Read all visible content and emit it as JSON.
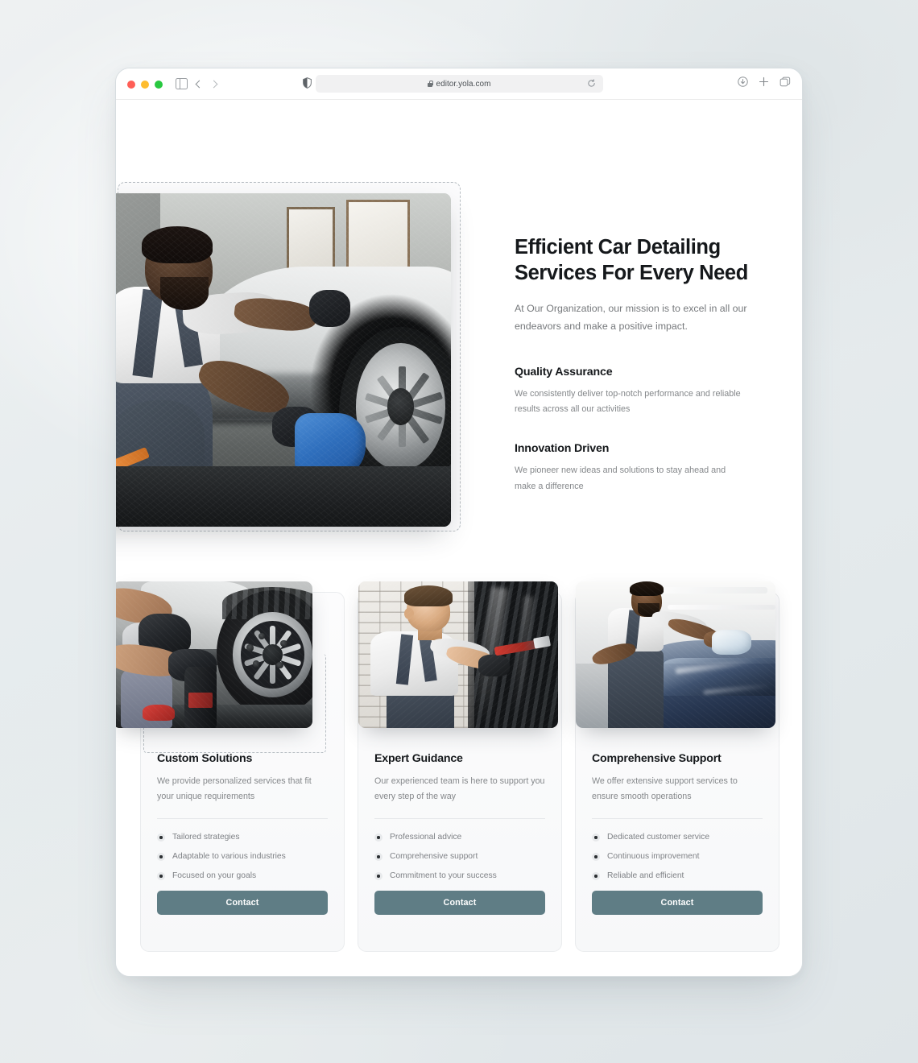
{
  "browser": {
    "url": "editor.yola.com",
    "traffic_lights": [
      "close",
      "minimize",
      "zoom"
    ],
    "icons": {
      "sidebar": "sidebar-icon",
      "back": "chevron-left-icon",
      "forward": "chevron-right-icon",
      "shield": "privacy-shield-icon",
      "lock": "lock-icon",
      "reload": "reload-icon",
      "download": "download-icon",
      "new_tab": "plus-icon",
      "tab_overview": "tab-overview-icon"
    }
  },
  "hero": {
    "heading": "Efficient Car Detailing Services For Every Need",
    "lead": "At Our Organization, our mission is to excel in all our endeavors and make a positive impact.",
    "image_alt": "Detailer crouching and wiping the wheel of a white car",
    "features": [
      {
        "title": "Quality Assurance",
        "body": "We consistently deliver top-notch performance and reliable results across all our activities"
      },
      {
        "title": "Innovation Driven",
        "body": "We pioneer new ideas and solutions to stay ahead and make a difference"
      }
    ]
  },
  "cards": [
    {
      "title": "Custom Solutions",
      "desc": "We provide personalized services that fit your unique requirements",
      "image_alt": "Gloved hands cleaning an alloy wheel with a spray bottle",
      "bullets": [
        "Tailored strategies",
        "Adaptable to various industries",
        "Focused on your goals"
      ],
      "button": "Contact"
    },
    {
      "title": "Expert Guidance",
      "desc": "Our experienced team is here to support you every step of the way",
      "image_alt": "Technician using a detailing brush on a car grille",
      "bullets": [
        "Professional advice",
        "Comprehensive support",
        "Commitment to your success"
      ],
      "button": "Contact"
    },
    {
      "title": "Comprehensive Support",
      "desc": "We offer extensive support services to ensure smooth operations",
      "image_alt": "Detailer wiping the roof of a dark blue car",
      "bullets": [
        "Dedicated customer service",
        "Continuous improvement",
        "Reliable and efficient"
      ],
      "button": "Contact"
    }
  ],
  "colors": {
    "button": "#5f7d85",
    "heading": "#15181b",
    "body_text": "#84878a",
    "selection_dashed": "#b9bfc4",
    "card_border": "#eaecee"
  }
}
